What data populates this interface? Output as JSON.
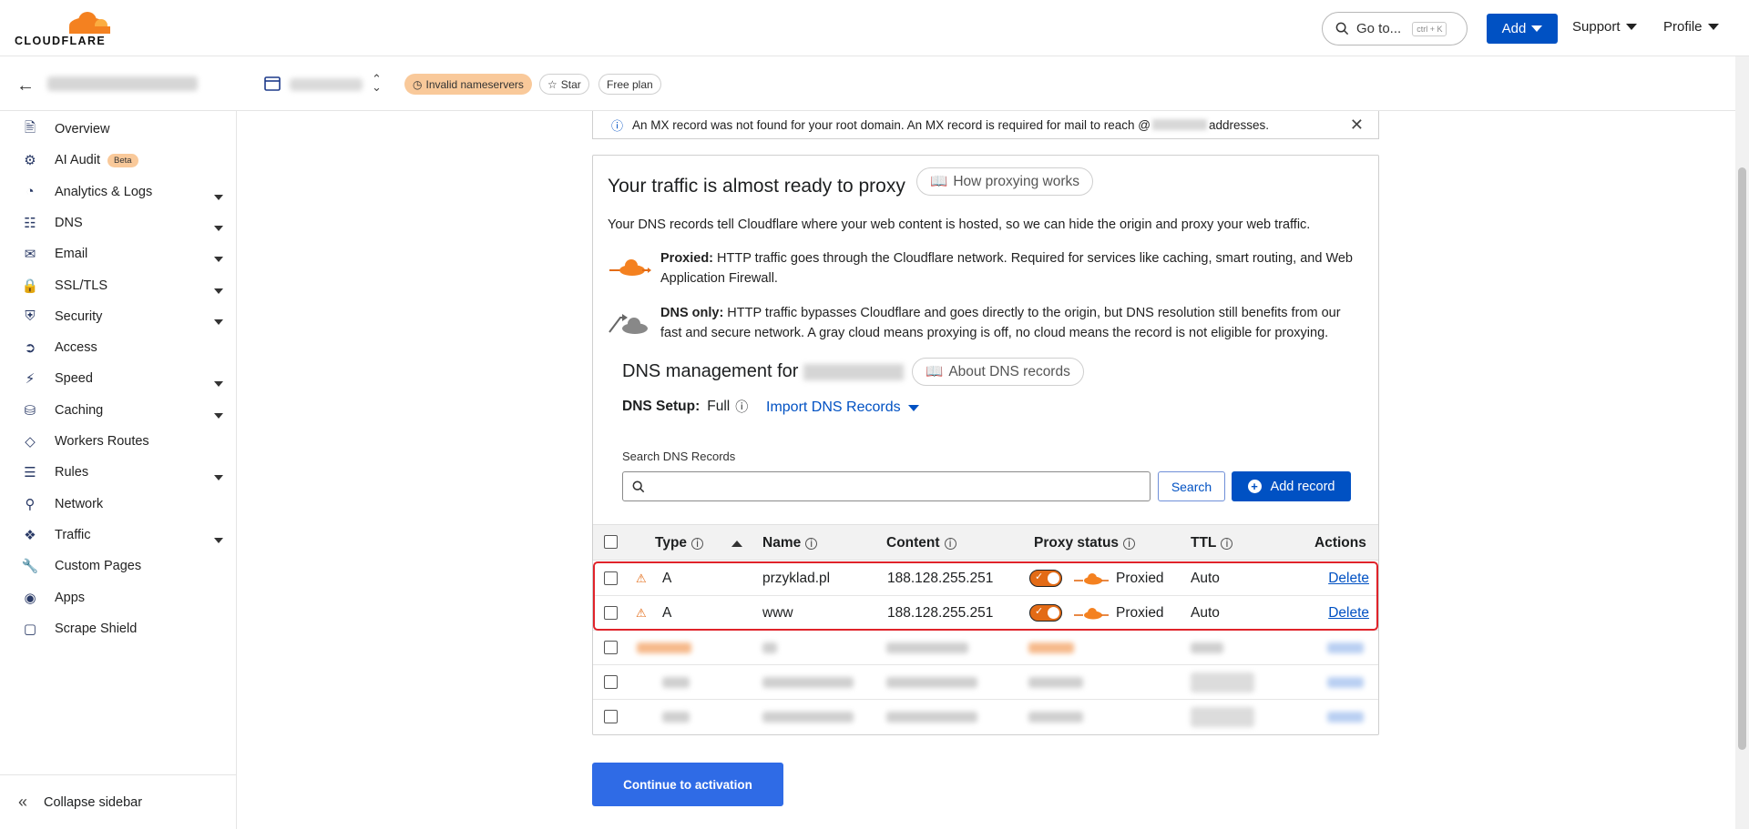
{
  "brand": {
    "logo_text": "CLOUDFLARE",
    "accent": "#f48120",
    "primary": "#0051c3"
  },
  "topbar": {
    "goto_label": "Go to...",
    "goto_shortcut": "ctrl + K",
    "add_label": "Add",
    "support_label": "Support",
    "profile_label": "Profile"
  },
  "subheader": {
    "invalid_ns_label": "Invalid nameservers",
    "star_label": "Star",
    "plan_label": "Free plan"
  },
  "sidebar": {
    "items": [
      {
        "label": "Overview",
        "icon": "document-icon",
        "has_caret": false
      },
      {
        "label": "AI Audit",
        "icon": "robot-icon",
        "has_caret": false,
        "badge": "Beta"
      },
      {
        "label": "Analytics & Logs",
        "icon": "pie-chart-icon",
        "has_caret": true
      },
      {
        "label": "DNS",
        "icon": "network-tree-icon",
        "has_caret": true
      },
      {
        "label": "Email",
        "icon": "envelope-icon",
        "has_caret": true
      },
      {
        "label": "SSL/TLS",
        "icon": "lock-icon",
        "has_caret": true
      },
      {
        "label": "Security",
        "icon": "shield-icon",
        "has_caret": true
      },
      {
        "label": "Access",
        "icon": "login-icon",
        "has_caret": false
      },
      {
        "label": "Speed",
        "icon": "lightning-icon",
        "has_caret": true
      },
      {
        "label": "Caching",
        "icon": "database-icon",
        "has_caret": true
      },
      {
        "label": "Workers Routes",
        "icon": "workers-icon",
        "has_caret": false
      },
      {
        "label": "Rules",
        "icon": "rules-icon",
        "has_caret": true
      },
      {
        "label": "Network",
        "icon": "pin-icon",
        "has_caret": false
      },
      {
        "label": "Traffic",
        "icon": "traffic-icon",
        "has_caret": true
      },
      {
        "label": "Custom Pages",
        "icon": "wrench-icon",
        "has_caret": false
      },
      {
        "label": "Apps",
        "icon": "apps-icon",
        "has_caret": false
      },
      {
        "label": "Scrape Shield",
        "icon": "scrape-shield-icon",
        "has_caret": false
      }
    ],
    "collapse_label": "Collapse sidebar"
  },
  "notice": {
    "text_before": "An MX record was not found for your root domain. An MX record is required for mail to reach @",
    "text_after": " addresses."
  },
  "card": {
    "title": "Your traffic is almost ready to proxy",
    "how_proxying_label": "How proxying works",
    "description": "Your DNS records tell Cloudflare where your web content is hosted, so we can hide the origin and proxy your web traffic.",
    "proxied_title": "Proxied:",
    "proxied_text": " HTTP traffic goes through the Cloudflare network. Required for services like caching, smart routing, and Web Application Firewall.",
    "dnsonly_title": "DNS only:",
    "dnsonly_text": " HTTP traffic bypasses Cloudflare and goes directly to the origin, but DNS resolution still benefits from our fast and secure network. A gray cloud means proxying is off, no cloud means the record is not eligible for proxying.",
    "dns_mgmt_label": "DNS management for",
    "about_dns_label": "About DNS records",
    "setup_label": "DNS Setup:",
    "setup_value": "Full",
    "import_label": "Import DNS Records",
    "search_label": "Search DNS Records",
    "search_placeholder": "",
    "search_button": "Search",
    "add_record_button": "Add record"
  },
  "table": {
    "columns": [
      "Type",
      "Name",
      "Content",
      "Proxy status",
      "TTL",
      "Actions"
    ],
    "rows": [
      {
        "type": "A",
        "name": "przyklad.pl",
        "content": "188.128.255.251",
        "proxy": "Proxied",
        "ttl": "Auto",
        "action": "Delete"
      },
      {
        "type": "A",
        "name": "www",
        "content": "188.128.255.251",
        "proxy": "Proxied",
        "ttl": "Auto",
        "action": "Delete"
      }
    ]
  },
  "continue_label": "Continue to activation"
}
